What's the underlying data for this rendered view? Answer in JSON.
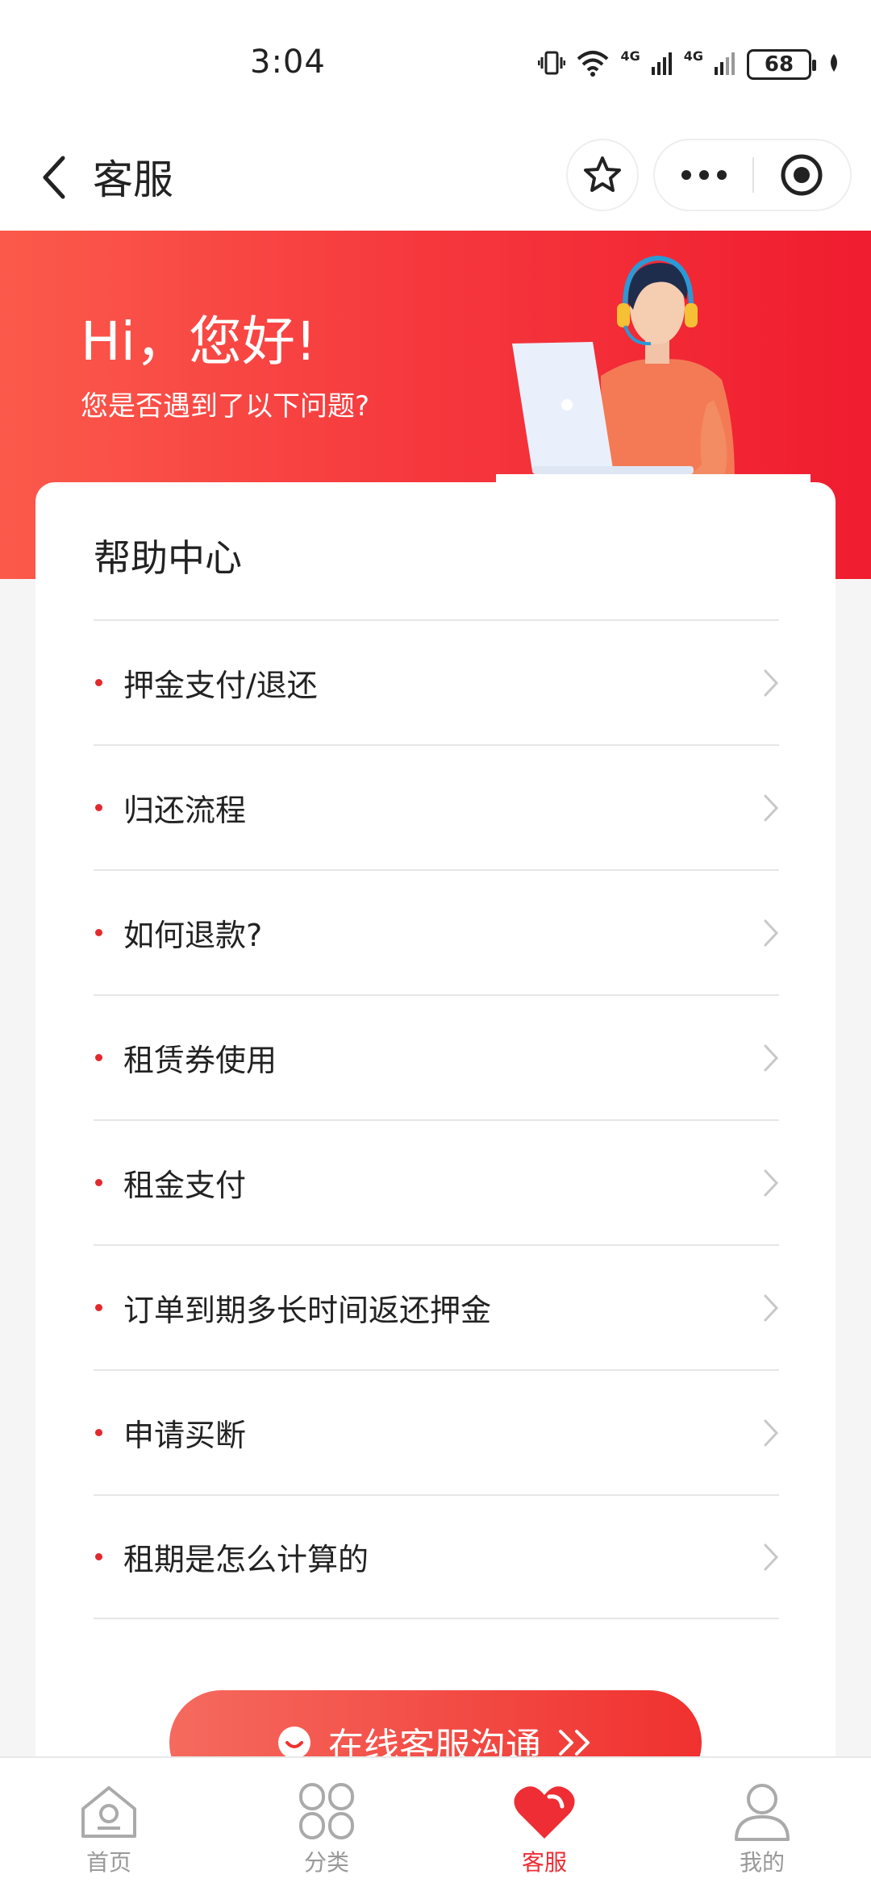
{
  "status_bar": {
    "time": "3:04",
    "signal_label": "4G",
    "battery": "68"
  },
  "nav": {
    "title": "客服"
  },
  "hero": {
    "title": "Hi，您好!",
    "subtitle": "您是否遇到了以下问题?"
  },
  "help_center": {
    "title": "帮助中心",
    "items": [
      {
        "label": "押金支付/退还"
      },
      {
        "label": "归还流程"
      },
      {
        "label": "如何退款?"
      },
      {
        "label": "租赁券使用"
      },
      {
        "label": "租金支付"
      },
      {
        "label": "订单到期多长时间返还押金"
      },
      {
        "label": "申请买断"
      },
      {
        "label": "租期是怎么计算的"
      }
    ],
    "online_button": "在线客服沟通"
  },
  "tabs": [
    {
      "label": "首页",
      "icon": "home-icon",
      "active": false
    },
    {
      "label": "分类",
      "icon": "category-icon",
      "active": false
    },
    {
      "label": "客服",
      "icon": "heart-icon",
      "active": true
    },
    {
      "label": "我的",
      "icon": "profile-icon",
      "active": false
    }
  ],
  "colors": {
    "accent": "#ee2d34",
    "hero_start": "#fb5a4b",
    "hero_end": "#f01c2f"
  }
}
